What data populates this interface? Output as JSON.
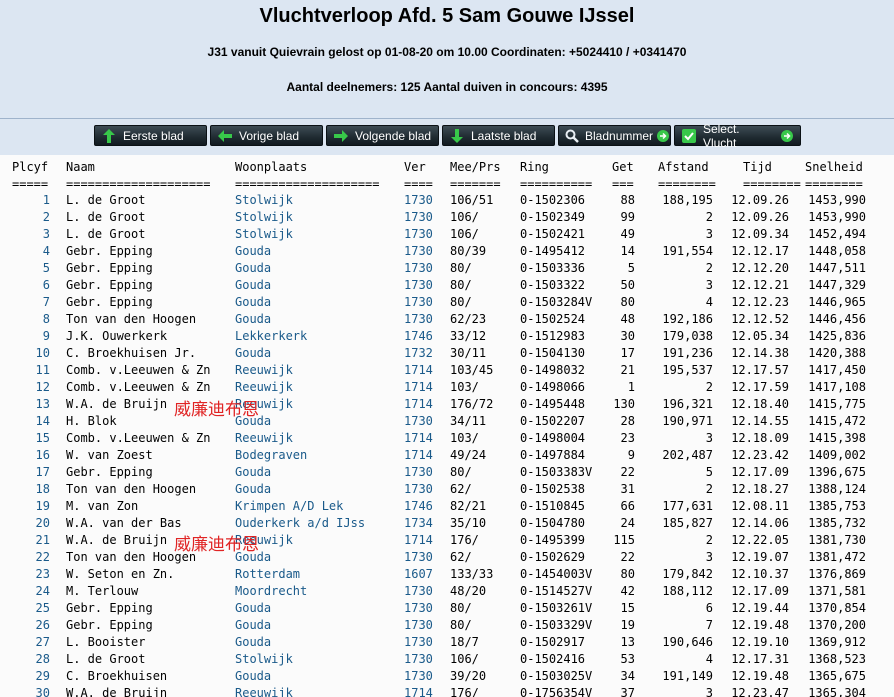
{
  "header": {
    "title": "Vluchtverloop Afd. 5 Sam Gouwe IJssel",
    "flight_info": "J31 vanuit Quievrain gelost op 01-08-20 om 10.00 Coordinaten: +5024410 / +0341470",
    "participants": "Aantal deelnemers: 125 Aantal duiven in concours: 4395"
  },
  "toolbar": {
    "first_page": "Eerste blad",
    "prev_page": "Vorige blad",
    "next_page": "Volgende blad",
    "last_page": "Laatste blad",
    "page_number": "Bladnummer",
    "select_flight": "Select. Vlucht"
  },
  "watermark": "威廉迪布恩",
  "columns": [
    "Plcyf",
    "Naam",
    "Woonplaats",
    "Ver",
    "Mee/Prs",
    "Ring",
    "Get",
    "Afstand",
    "Tijd",
    "Snelheid"
  ],
  "separators": [
    "=====",
    "====================",
    "====================",
    "====",
    "=======",
    "==========",
    "===",
    "========",
    "========",
    "========"
  ],
  "rows": [
    [
      "1",
      "L. de Groot",
      "Stolwijk",
      "1730",
      "106/51",
      "0-1502306",
      "88",
      "188,195",
      "12.09.26",
      "1453,990"
    ],
    [
      "2",
      "L. de Groot",
      "Stolwijk",
      "1730",
      "106/",
      "0-1502349",
      "99",
      "2",
      "12.09.26",
      "1453,990"
    ],
    [
      "3",
      "L. de Groot",
      "Stolwijk",
      "1730",
      "106/",
      "0-1502421",
      "49",
      "3",
      "12.09.34",
      "1452,494"
    ],
    [
      "4",
      "Gebr. Epping",
      "Gouda",
      "1730",
      "80/39",
      "0-1495412",
      "14",
      "191,554",
      "12.12.17",
      "1448,058"
    ],
    [
      "5",
      "Gebr. Epping",
      "Gouda",
      "1730",
      "80/",
      "0-1503336",
      "5",
      "2",
      "12.12.20",
      "1447,511"
    ],
    [
      "6",
      "Gebr. Epping",
      "Gouda",
      "1730",
      "80/",
      "0-1503322",
      "50",
      "3",
      "12.12.21",
      "1447,329"
    ],
    [
      "7",
      "Gebr. Epping",
      "Gouda",
      "1730",
      "80/",
      "0-1503284V",
      "80",
      "4",
      "12.12.23",
      "1446,965"
    ],
    [
      "8",
      "Ton van den Hoogen",
      "Gouda",
      "1730",
      "62/23",
      "0-1502524",
      "48",
      "192,186",
      "12.12.52",
      "1446,456"
    ],
    [
      "9",
      "J.K. Ouwerkerk",
      "Lekkerkerk",
      "1746",
      "33/12",
      "0-1512983",
      "30",
      "179,038",
      "12.05.34",
      "1425,836"
    ],
    [
      "10",
      "C. Broekhuisen Jr.",
      "Gouda",
      "1732",
      "30/11",
      "0-1504130",
      "17",
      "191,236",
      "12.14.38",
      "1420,388"
    ],
    [
      "11",
      "Comb. v.Leeuwen & Zn",
      "Reeuwijk",
      "1714",
      "103/45",
      "0-1498032",
      "21",
      "195,537",
      "12.17.57",
      "1417,450"
    ],
    [
      "12",
      "Comb. v.Leeuwen & Zn",
      "Reeuwijk",
      "1714",
      "103/",
      "0-1498066",
      "1",
      "2",
      "12.17.59",
      "1417,108"
    ],
    [
      "13",
      "W.A. de Bruijn",
      "Reeuwijk",
      "1714",
      "176/72",
      "0-1495448",
      "130",
      "196,321",
      "12.18.40",
      "1415,775"
    ],
    [
      "14",
      "H. Blok",
      "Gouda",
      "1730",
      "34/11",
      "0-1502207",
      "28",
      "190,971",
      "12.14.55",
      "1415,472"
    ],
    [
      "15",
      "Comb. v.Leeuwen & Zn",
      "Reeuwijk",
      "1714",
      "103/",
      "0-1498004",
      "23",
      "3",
      "12.18.09",
      "1415,398"
    ],
    [
      "16",
      "W. van Zoest",
      "Bodegraven",
      "1714",
      "49/24",
      "0-1497884",
      "9",
      "202,487",
      "12.23.42",
      "1409,002"
    ],
    [
      "17",
      "Gebr. Epping",
      "Gouda",
      "1730",
      "80/",
      "0-1503383V",
      "22",
      "5",
      "12.17.09",
      "1396,675"
    ],
    [
      "18",
      "Ton van den Hoogen",
      "Gouda",
      "1730",
      "62/",
      "0-1502538",
      "31",
      "2",
      "12.18.27",
      "1388,124"
    ],
    [
      "19",
      "M. van Zon",
      "Krimpen A/D Lek",
      "1746",
      "82/21",
      "0-1510845",
      "66",
      "177,631",
      "12.08.11",
      "1385,753"
    ],
    [
      "20",
      "W.A. van der Bas",
      "Ouderkerk a/d IJss",
      "1734",
      "35/10",
      "0-1504780",
      "24",
      "185,827",
      "12.14.06",
      "1385,732"
    ],
    [
      "21",
      "W.A. de Bruijn",
      "Reeuwijk",
      "1714",
      "176/",
      "0-1495399",
      "115",
      "2",
      "12.22.05",
      "1381,730"
    ],
    [
      "22",
      "Ton van den Hoogen",
      "Gouda",
      "1730",
      "62/",
      "0-1502629",
      "22",
      "3",
      "12.19.07",
      "1381,472"
    ],
    [
      "23",
      "W. Seton en Zn.",
      "Rotterdam",
      "1607",
      "133/33",
      "0-1454003V",
      "80",
      "179,842",
      "12.10.37",
      "1376,869"
    ],
    [
      "24",
      "M. Terlouw",
      "Moordrecht",
      "1730",
      "48/20",
      "0-1514527V",
      "42",
      "188,112",
      "12.17.09",
      "1371,581"
    ],
    [
      "25",
      "Gebr. Epping",
      "Gouda",
      "1730",
      "80/",
      "0-1503261V",
      "15",
      "6",
      "12.19.44",
      "1370,854"
    ],
    [
      "26",
      "Gebr. Epping",
      "Gouda",
      "1730",
      "80/",
      "0-1503329V",
      "19",
      "7",
      "12.19.48",
      "1370,200"
    ],
    [
      "27",
      "L. Booister",
      "Gouda",
      "1730",
      "18/7",
      "0-1502917",
      "13",
      "190,646",
      "12.19.10",
      "1369,912"
    ],
    [
      "28",
      "L. de Groot",
      "Stolwijk",
      "1730",
      "106/",
      "0-1502416",
      "53",
      "4",
      "12.17.31",
      "1368,523"
    ],
    [
      "29",
      "C. Broekhuisen",
      "Gouda",
      "1730",
      "39/20",
      "0-1503025V",
      "34",
      "191,149",
      "12.19.48",
      "1365,675"
    ],
    [
      "30",
      "W.A. de Bruijn",
      "Reeuwijk",
      "1714",
      "176/",
      "0-1756354V",
      "37",
      "3",
      "12.23.47",
      "1365,304"
    ]
  ]
}
